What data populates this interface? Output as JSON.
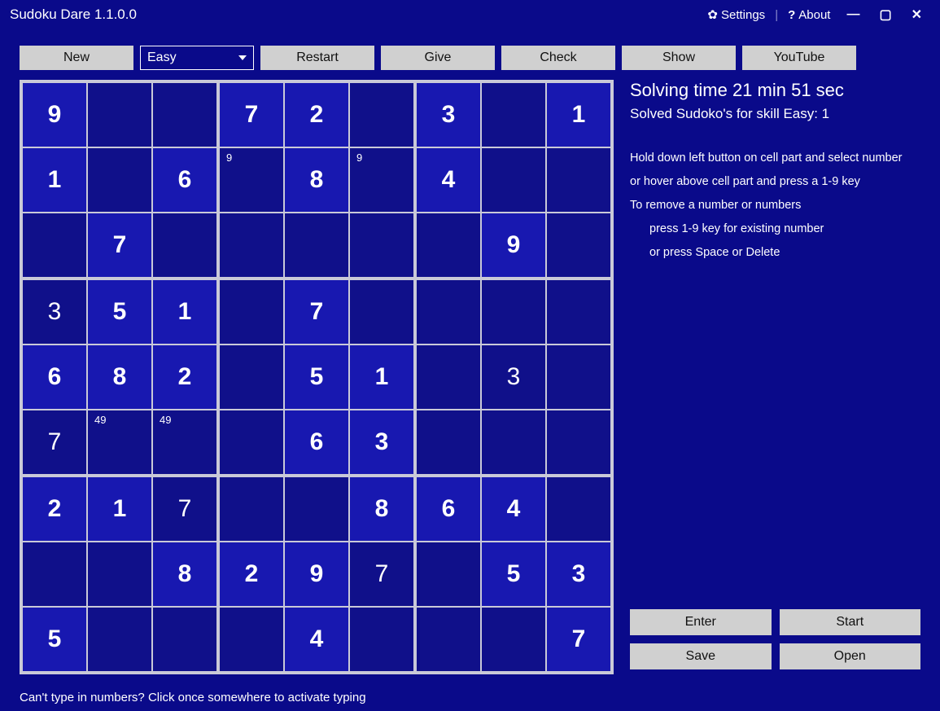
{
  "window": {
    "title": "Sudoku Dare 1.1.0.0",
    "settings": "Settings",
    "about": "About"
  },
  "toolbar": {
    "new": "New",
    "difficulty": "Easy",
    "restart": "Restart",
    "give": "Give",
    "check": "Check",
    "show": "Show",
    "youtube": "YouTube"
  },
  "side": {
    "solving_time": "Solving time 21 min 51 sec",
    "solved_count": "Solved Sudoko's for skill Easy: 1",
    "help1": "Hold down left button on cell part and select number",
    "help2": "or hover above cell part and press a 1-9 key",
    "help3": "To remove a number or numbers",
    "help4": "press 1-9 key for existing number",
    "help5": "or press Space or Delete",
    "enter": "Enter",
    "start": "Start",
    "save": "Save",
    "open": "Open"
  },
  "footer": "Can't type in numbers? Click once somewhere to activate typing",
  "grid": [
    [
      {
        "v": "9",
        "given": true
      },
      {
        "v": ""
      },
      {
        "v": ""
      },
      {
        "v": "7",
        "given": true
      },
      {
        "v": "2",
        "given": true
      },
      {
        "v": ""
      },
      {
        "v": "3",
        "given": true
      },
      {
        "v": ""
      },
      {
        "v": "1",
        "given": true
      }
    ],
    [
      {
        "v": "1",
        "given": true
      },
      {
        "v": ""
      },
      {
        "v": "6",
        "given": true
      },
      {
        "note": "9"
      },
      {
        "v": "8",
        "given": true
      },
      {
        "note": "9"
      },
      {
        "v": "4",
        "given": true
      },
      {
        "v": ""
      },
      {
        "v": ""
      }
    ],
    [
      {
        "v": ""
      },
      {
        "v": "7",
        "given": true
      },
      {
        "v": ""
      },
      {
        "v": ""
      },
      {
        "v": ""
      },
      {
        "v": ""
      },
      {
        "v": ""
      },
      {
        "v": "9",
        "given": true
      },
      {
        "v": ""
      }
    ],
    [
      {
        "v": "3"
      },
      {
        "v": "5",
        "given": true
      },
      {
        "v": "1",
        "given": true
      },
      {
        "v": ""
      },
      {
        "v": "7",
        "given": true
      },
      {
        "v": ""
      },
      {
        "v": ""
      },
      {
        "v": ""
      },
      {
        "v": ""
      }
    ],
    [
      {
        "v": "6",
        "given": true
      },
      {
        "v": "8",
        "given": true
      },
      {
        "v": "2",
        "given": true
      },
      {
        "v": ""
      },
      {
        "v": "5",
        "given": true
      },
      {
        "v": "1",
        "given": true
      },
      {
        "v": ""
      },
      {
        "v": "3"
      },
      {
        "v": ""
      }
    ],
    [
      {
        "v": "7"
      },
      {
        "note": "49"
      },
      {
        "note": "49"
      },
      {
        "v": ""
      },
      {
        "v": "6",
        "given": true
      },
      {
        "v": "3",
        "given": true
      },
      {
        "v": ""
      },
      {
        "v": ""
      },
      {
        "v": ""
      }
    ],
    [
      {
        "v": "2",
        "given": true
      },
      {
        "v": "1",
        "given": true
      },
      {
        "v": "7"
      },
      {
        "v": ""
      },
      {
        "v": ""
      },
      {
        "v": "8",
        "given": true
      },
      {
        "v": "6",
        "given": true
      },
      {
        "v": "4",
        "given": true
      },
      {
        "v": ""
      }
    ],
    [
      {
        "v": ""
      },
      {
        "v": ""
      },
      {
        "v": "8",
        "given": true
      },
      {
        "v": "2",
        "given": true
      },
      {
        "v": "9",
        "given": true
      },
      {
        "v": "7"
      },
      {
        "v": ""
      },
      {
        "v": "5",
        "given": true
      },
      {
        "v": "3",
        "given": true
      }
    ],
    [
      {
        "v": "5",
        "given": true
      },
      {
        "v": ""
      },
      {
        "v": ""
      },
      {
        "v": ""
      },
      {
        "v": "4",
        "given": true
      },
      {
        "v": ""
      },
      {
        "v": ""
      },
      {
        "v": ""
      },
      {
        "v": "7",
        "given": true
      }
    ]
  ]
}
